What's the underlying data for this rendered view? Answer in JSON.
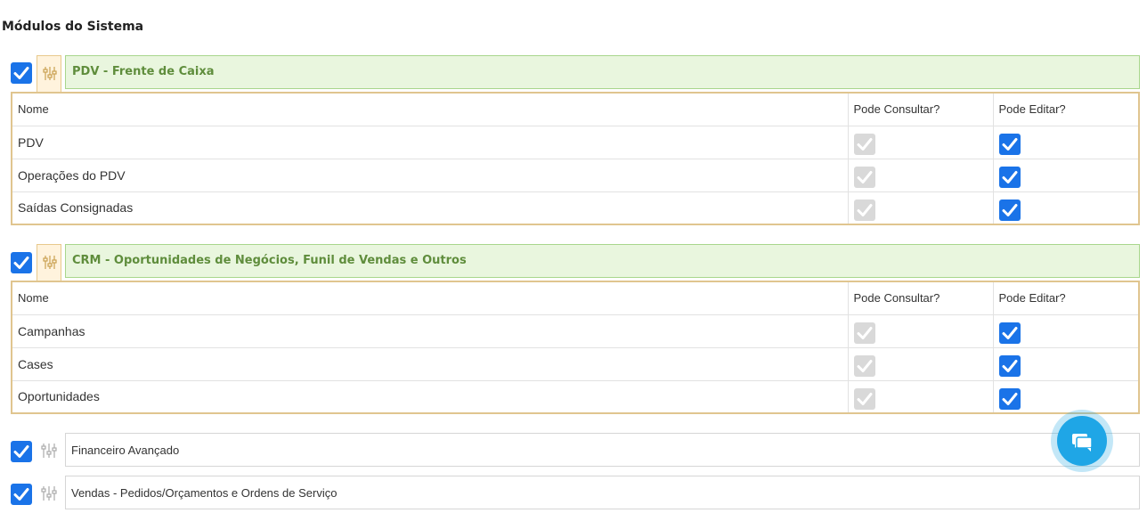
{
  "page": {
    "title": "Módulos do Sistema"
  },
  "table_headers": {
    "name": "Nome",
    "consult": "Pode Consultar?",
    "edit": "Pode Editar?"
  },
  "modules": [
    {
      "title": "PDV - Frente de Caixa",
      "checked": true,
      "expanded": true,
      "rows": [
        {
          "name": "PDV",
          "consult": "disabled-checked",
          "edit": "checked"
        },
        {
          "name": "Operações do PDV",
          "consult": "disabled-checked",
          "edit": "checked"
        },
        {
          "name": "Saídas Consignadas",
          "consult": "disabled-checked",
          "edit": "checked"
        }
      ]
    },
    {
      "title": "CRM - Oportunidades de Negócios, Funil de Vendas e Outros",
      "checked": true,
      "expanded": true,
      "rows": [
        {
          "name": "Campanhas",
          "consult": "disabled-checked",
          "edit": "checked"
        },
        {
          "name": "Cases",
          "consult": "disabled-checked",
          "edit": "checked"
        },
        {
          "name": "Oportunidades",
          "consult": "disabled-checked",
          "edit": "checked"
        }
      ]
    },
    {
      "title": "Financeiro Avançado",
      "checked": true,
      "expanded": false
    },
    {
      "title": "Vendas - Pedidos/Orçamentos e Ordens de Serviço",
      "checked": true,
      "expanded": false
    }
  ],
  "colors": {
    "accent": "#1a73e8",
    "header_bg": "#e9f6de",
    "header_text": "#5f8d3c",
    "table_border": "#e0c58f",
    "chat_fab": "#1fa6e6"
  },
  "icons": {
    "module_settings": "sliders-icon",
    "chat": "chat-icon",
    "check": "checkmark-icon"
  }
}
